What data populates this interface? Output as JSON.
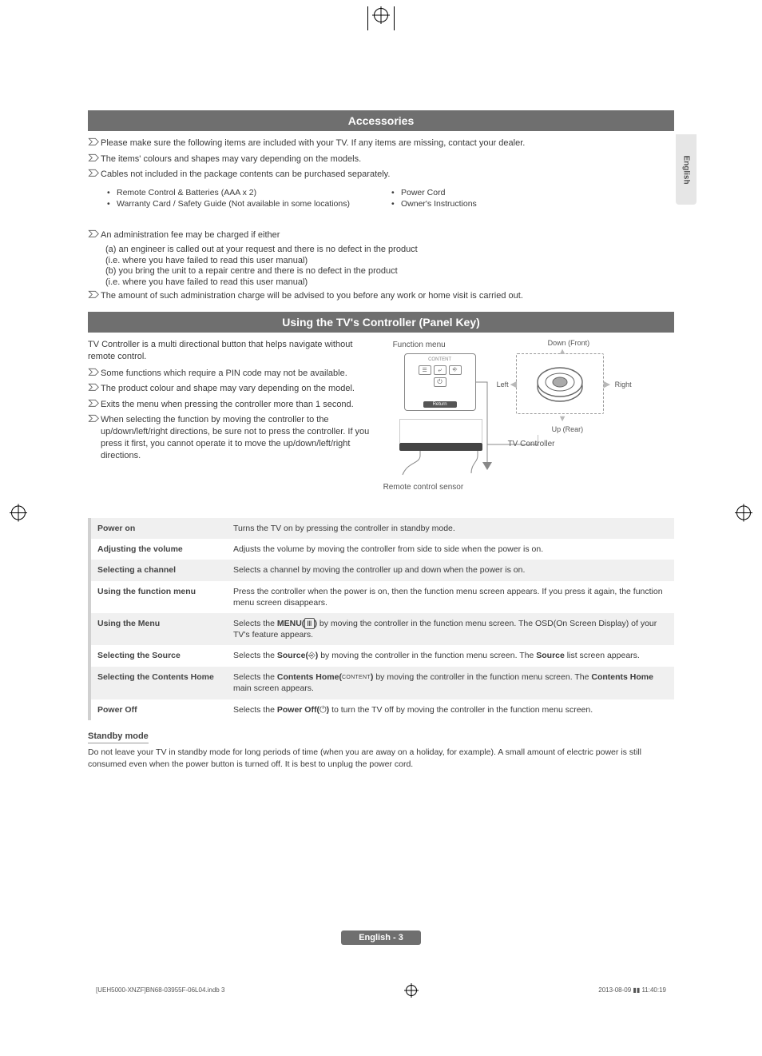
{
  "lang_tab": "English",
  "sections": {
    "accessories_title": "Accessories",
    "controller_title": "Using the TV's Controller (Panel Key)"
  },
  "accessories_notes": {
    "n1": "Please make sure the following items are included with your TV. If any items are missing, contact your dealer.",
    "n2": "The items' colours and shapes may vary depending on the models.",
    "n3": "Cables not included in the package contents can be purchased separately."
  },
  "accessories_items": {
    "left": [
      "Remote Control & Batteries (AAA x 2)",
      "Warranty Card / Safety Guide (Not available in some locations)"
    ],
    "right": [
      "Power Cord",
      "Owner's Instructions"
    ]
  },
  "admin_fee": {
    "head": "An administration fee may be charged if either",
    "a": "(a) an engineer is called out at your request and there is no defect in the product",
    "a_sub": "(i.e. where you have failed to read this user manual)",
    "b": "(b) you bring the unit to a repair centre and there is no defect in the product",
    "b_sub": "(i.e. where you have failed to read this user manual)",
    "tail": "The amount of such administration charge will be advised to you before any work or home visit is carried out."
  },
  "controller_intro": "TV Controller is a multi directional button that helps navigate without remote control.",
  "controller_notes": {
    "n1": "Some functions which require a PIN code may not be available.",
    "n2": "The product colour and shape may vary depending on the model.",
    "n3": "Exits the menu when pressing the controller more than 1 second.",
    "n4": "When selecting the function by moving the controller to the up/down/left/right directions, be sure not to press the controller. If you press it first, you cannot operate it to move the up/down/left/right directions."
  },
  "diagram": {
    "function_menu": "Function menu",
    "return": "Return",
    "remote_sensor": "Remote control sensor",
    "tv_controller": "TV Controller",
    "down_front": "Down (Front)",
    "up_rear": "Up (Rear)",
    "left": "Left",
    "right": "Right"
  },
  "table": [
    {
      "label": "Power on",
      "desc_pre": "Turns the TV on by pressing the controller in standby mode.",
      "alt": true
    },
    {
      "label": "Adjusting the volume",
      "desc_pre": "Adjusts the volume by moving the controller from side to side when the power is on.",
      "alt": false
    },
    {
      "label": "Selecting a channel",
      "desc_pre": "Selects a channel by moving the controller up and down when the power is on.",
      "alt": true
    },
    {
      "label": "Using the function menu",
      "desc_pre": "Press the controller when the power is on, then the function menu screen appears. If you press it again, the function menu screen disappears.",
      "alt": false
    },
    {
      "label": "Using the Menu",
      "desc_pre": "Selects the ",
      "bold1": "MENU(",
      "icon": "menu",
      "bold1b": ")",
      "desc_post": " by moving the controller in the function menu screen. The OSD(On Screen Display) of your TV's feature appears.",
      "alt": true
    },
    {
      "label": "Selecting the Source",
      "desc_pre": "Selects the ",
      "bold1": "Source(",
      "icon": "source",
      "bold1b": ")",
      "desc_post": " by moving the controller in the function menu screen. The ",
      "bold2": "Source",
      "desc_post2": " list screen appears.",
      "alt": false
    },
    {
      "label": "Selecting the Contents Home",
      "desc_pre": "Selects the ",
      "bold1": "Contents Home(",
      "icon": "content",
      "bold1b": ")",
      "desc_post": " by moving the controller in the function menu screen. The ",
      "bold2": "Contents Home",
      "desc_post2": " main screen appears.",
      "alt": true
    },
    {
      "label": "Power Off",
      "desc_pre": "Selects the ",
      "bold1": "Power Off(",
      "icon": "power",
      "bold1b": ")",
      "desc_post": " to turn the TV off by moving the controller in the function menu screen.",
      "alt": false
    }
  ],
  "standby": {
    "head": "Standby mode",
    "body": "Do not leave your TV in standby mode for long periods of time (when you are away on a holiday, for example). A small amount of electric power is still consumed even when the power button is turned off. It is best to unplug the power cord."
  },
  "page_foot": "English - 3",
  "footer": {
    "left": "[UEH5000-XNZF]BN68-03955F-06L04.indb   3",
    "right": "2013-08-09   ▮▮ 11:40:19"
  }
}
